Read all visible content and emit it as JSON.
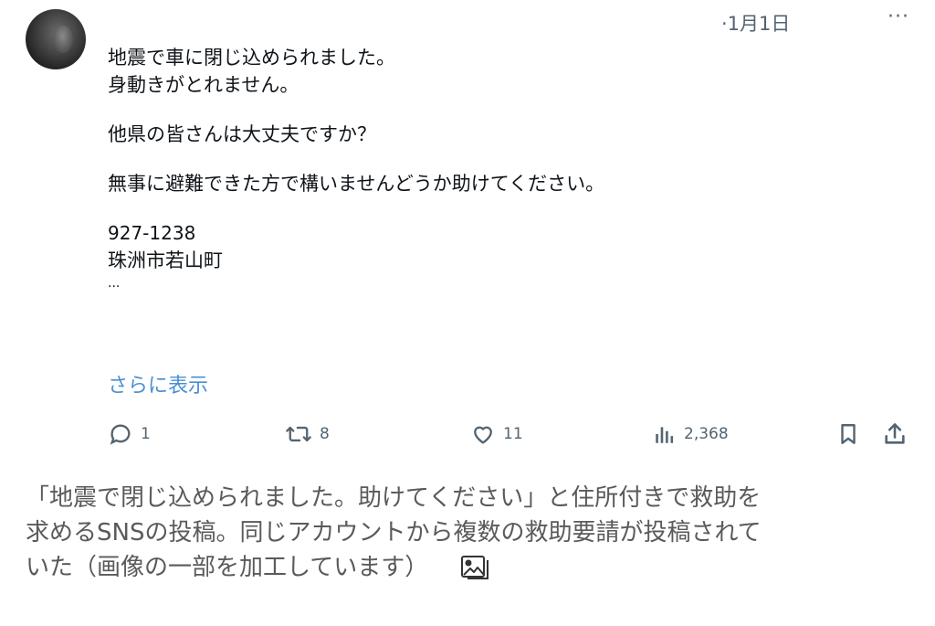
{
  "post": {
    "date": "·1月1日",
    "more": "···",
    "lines": [
      "地震で車に閉じ込められました。",
      "身動きがとれません。",
      "他県の皆さんは大丈夫ですか？",
      "無事に避難できた方で構いませんどうか助けてください。",
      "927-1238",
      "珠洲市若山町",
      "..."
    ],
    "show_more": "さらに表示",
    "actions": {
      "reply_count": "1",
      "repost_count": "8",
      "like_count": "11",
      "view_count": "2,368"
    }
  },
  "caption": {
    "lines": [
      "「地震で閉じ込められました。助けてください」と住所付きで救助を",
      "求めるSNSの投稿。同じアカウントから複数の救助要請が投稿されて",
      "いた（画像の一部を加工しています）"
    ]
  }
}
